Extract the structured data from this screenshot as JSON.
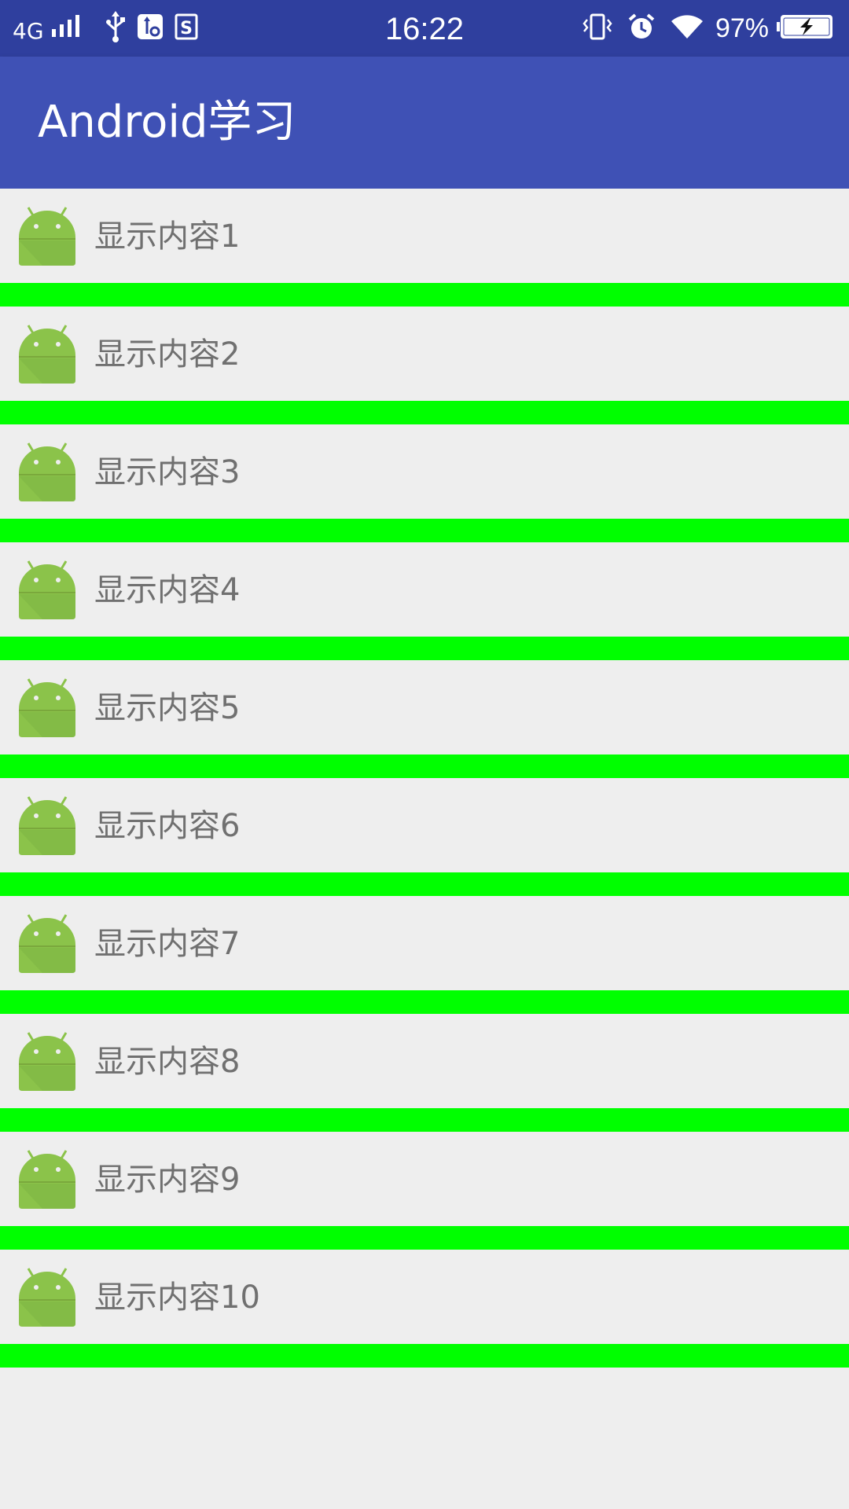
{
  "status_bar": {
    "network": "4G",
    "time": "16:22",
    "battery_percent": "97%",
    "icons": [
      "signal-icon",
      "usb-icon",
      "usb-debug-icon",
      "screenshot-app-icon",
      "vibrate-icon",
      "alarm-icon",
      "wifi-icon",
      "battery-charging-icon"
    ]
  },
  "app_bar": {
    "title": "Android学习"
  },
  "list": {
    "items": [
      {
        "label": "显示内容1",
        "icon": "android-icon"
      },
      {
        "label": "显示内容2",
        "icon": "android-icon"
      },
      {
        "label": "显示内容3",
        "icon": "android-icon"
      },
      {
        "label": "显示内容4",
        "icon": "android-icon"
      },
      {
        "label": "显示内容5",
        "icon": "android-icon"
      },
      {
        "label": "显示内容6",
        "icon": "android-icon"
      },
      {
        "label": "显示内容7",
        "icon": "android-icon"
      },
      {
        "label": "显示内容8",
        "icon": "android-icon"
      },
      {
        "label": "显示内容9",
        "icon": "android-icon"
      },
      {
        "label": "显示内容10",
        "icon": "android-icon"
      }
    ]
  },
  "colors": {
    "status_bar": "#2f3f9e",
    "app_bar": "#3f51b5",
    "divider": "#00ff00",
    "background": "#eeeeee",
    "item_text": "#707070",
    "android_green": "#8bc34a"
  }
}
